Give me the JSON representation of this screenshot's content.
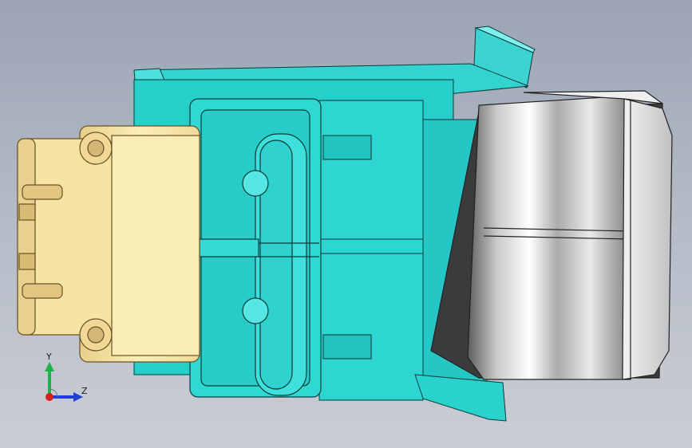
{
  "viewport": {
    "background_top": "#9aa4b4",
    "background_bottom": "#c9cdd5"
  },
  "model": {
    "name": "",
    "colors": {
      "housing": "#2fd7d3",
      "housing_dark": "#17a9a7",
      "housing_light": "#6eeceb",
      "connector": "#f5e3a0",
      "connector_dark": "#caa867",
      "rocker": "#8b8d8e",
      "rocker_light": "#e8e8e8",
      "edges": "#0a3b3b"
    }
  },
  "triad": {
    "y_label": "Y",
    "z_label": "Z",
    "y_color": "#19b34a",
    "z_color": "#1f3fd8",
    "x_color": "#d81f1f"
  }
}
